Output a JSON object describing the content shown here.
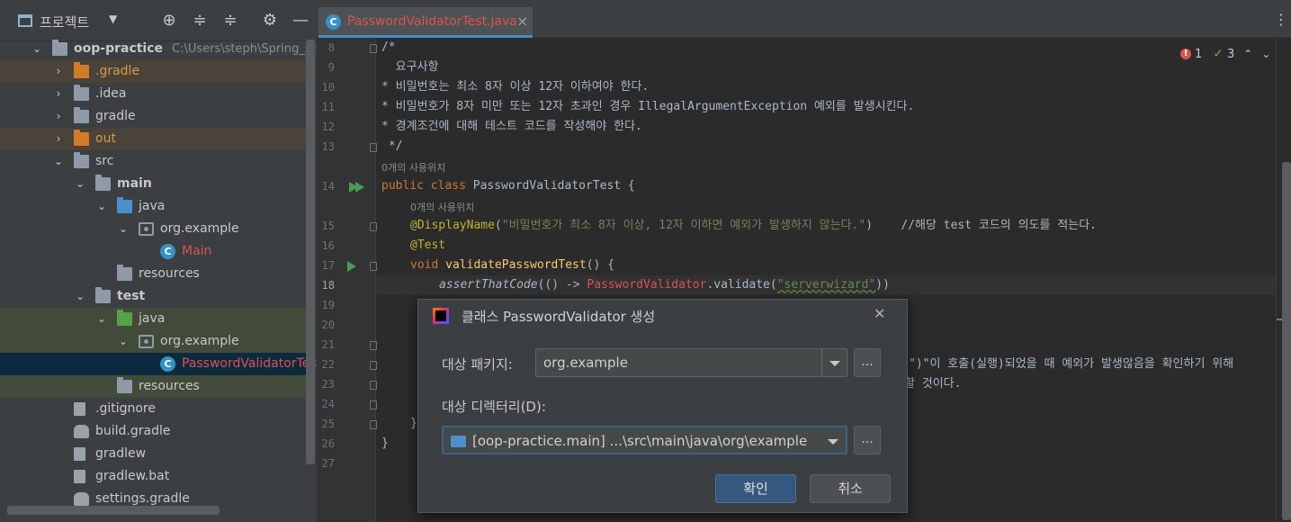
{
  "project_panel": {
    "title": "프로젝트",
    "toolbar_icons": [
      "locate-icon",
      "expand-all-icon",
      "collapse-all-icon",
      "gear-icon",
      "hide-icon"
    ],
    "tree": [
      {
        "label": "oop-practice",
        "path": "C:\\Users\\steph\\Spring_stud",
        "depth": 0,
        "expanded": true,
        "icon": "module-folder-icon",
        "bold": true
      },
      {
        "label": ".gradle",
        "depth": 1,
        "expanded": false,
        "icon": "folder-orange-icon",
        "style": "orange",
        "hl": "brown"
      },
      {
        "label": ".idea",
        "depth": 1,
        "expanded": false,
        "icon": "folder-icon"
      },
      {
        "label": "gradle",
        "depth": 1,
        "expanded": false,
        "icon": "folder-icon"
      },
      {
        "label": "out",
        "depth": 1,
        "expanded": false,
        "icon": "folder-orange-icon",
        "style": "orange",
        "hl": "brown"
      },
      {
        "label": "src",
        "depth": 1,
        "expanded": true,
        "icon": "folder-icon"
      },
      {
        "label": "main",
        "depth": 2,
        "expanded": true,
        "icon": "folder-icon",
        "bold": true
      },
      {
        "label": "java",
        "depth": 3,
        "expanded": true,
        "icon": "folder-blue-icon"
      },
      {
        "label": "org.example",
        "depth": 4,
        "expanded": true,
        "icon": "package-icon"
      },
      {
        "label": "Main",
        "depth": 5,
        "icon": "class-icon",
        "style": "red"
      },
      {
        "label": "resources",
        "depth": 3,
        "icon": "resources-folder-icon"
      },
      {
        "label": "test",
        "depth": 2,
        "expanded": true,
        "icon": "folder-icon",
        "bold": true
      },
      {
        "label": "java",
        "depth": 3,
        "expanded": true,
        "icon": "folder-green-icon",
        "hl": "green"
      },
      {
        "label": "org.example",
        "depth": 4,
        "expanded": true,
        "icon": "package-icon",
        "hl": "green"
      },
      {
        "label": "PasswordValidatorTest",
        "depth": 5,
        "icon": "test-class-icon",
        "style": "red",
        "selected": true
      },
      {
        "label": "resources",
        "depth": 3,
        "icon": "test-resources-folder-icon",
        "hl": "green"
      },
      {
        "label": ".gitignore",
        "depth": 1,
        "icon": "gitignore-file-icon"
      },
      {
        "label": "build.gradle",
        "depth": 1,
        "icon": "gradle-icon"
      },
      {
        "label": "gradlew",
        "depth": 1,
        "icon": "shell-file-icon"
      },
      {
        "label": "gradlew.bat",
        "depth": 1,
        "icon": "bat-file-icon"
      },
      {
        "label": "settings.gradle",
        "depth": 1,
        "icon": "gradle-icon"
      }
    ]
  },
  "editor": {
    "tab": {
      "name": "PasswordValidatorTest.java",
      "icon": "test-class-icon"
    },
    "inspections": {
      "errors": "1",
      "warnings": "3"
    },
    "line_numbers": [
      "8",
      "9",
      "10",
      "11",
      "12",
      "13",
      "14",
      "15",
      "16",
      "17",
      "18",
      "19",
      "20",
      "21",
      "22",
      "23",
      "24",
      "25",
      "26",
      "27"
    ],
    "current_line": "18",
    "hints": {
      "class_usages": "0개의 사용위치",
      "method_usages": "0개의 사용위치"
    },
    "lines": {
      "l8": "/*",
      "l9": "  요구사항",
      "l10": "* 비밀번호는 최소 8자 이상 12자 이하여야 한다.",
      "l11": "* 비밀번호가 8자 미만 또는 12자 초과인 경우 IllegalArgumentException 예외를 발생시킨다.",
      "l12": "* 경계조건에 대해 테스트 코드를 작성해야 한다.",
      "l13": " */",
      "l14_kw": "public class",
      "l14_rest": " PasswordValidatorTest {",
      "l15_ann": "@DisplayName",
      "l15_open": "(",
      "l15_str": "\"비밀번호가 최소 8자 이상, 12자 이하면 예외가 발생하지 않는다.\"",
      "l15_close": ")",
      "l15_comment": "    //해당 test 코드의 의도를 적는다.",
      "l16_ann": "@Test",
      "l17_kw": "void",
      "l17_fn": "validatePasswordTest",
      "l17_rest": "() {",
      "l18_call": "assertThatCode",
      "l18_mid": "(() -> ",
      "l18_cls": "PasswordValidator",
      "l18_dot": ".validate(",
      "l18_str": "\"serverwizard\"",
      "l18_end": "))",
      "l22_tail": "\")\"이 호출(실행)되었을 때 예외가 발생않음을 확인하기 위해",
      "l23_tail": "과할 것이다.",
      "l25": "}",
      "l26": "}"
    }
  },
  "dialog": {
    "title": "클래스 PasswordValidator 생성",
    "package_label": "대상 패키지:",
    "package_value": "org.example",
    "dir_label": "대상 디렉터리(D):",
    "dir_value": "[oop-practice.main] ...\\src\\main\\java\\org\\example",
    "browse_label": "...",
    "ok_label": "확인",
    "cancel_label": "취소"
  }
}
